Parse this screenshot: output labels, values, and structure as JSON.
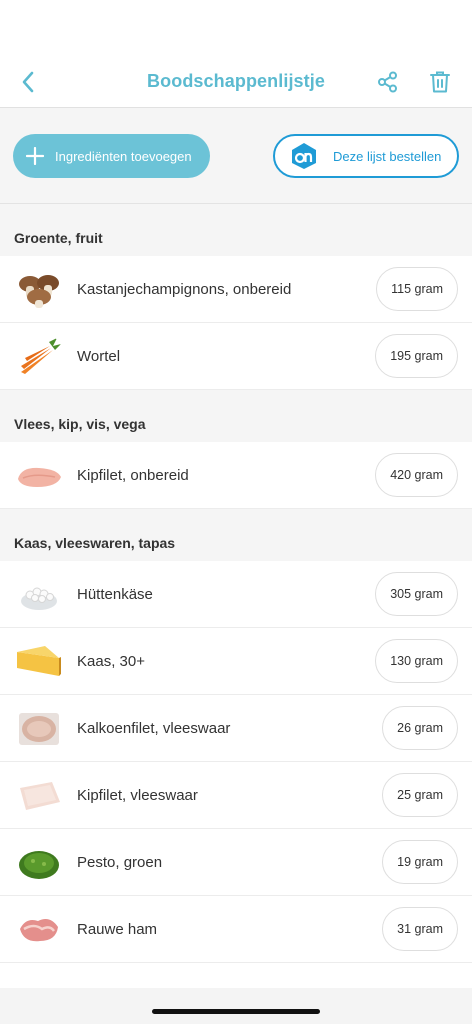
{
  "header": {
    "title": "Boodschappenlijstje"
  },
  "actions": {
    "add_label": "Ingrediënten toevoegen",
    "order_label": "Deze lijst bestellen"
  },
  "sections": [
    {
      "title": "Groente, fruit",
      "items": [
        {
          "name": "Kastanjechampignons, onbereid",
          "qty": "115 gram"
        },
        {
          "name": "Wortel",
          "qty": "195 gram"
        }
      ]
    },
    {
      "title": "Vlees, kip, vis, vega",
      "items": [
        {
          "name": "Kipfilet, onbereid",
          "qty": "420 gram"
        }
      ]
    },
    {
      "title": "Kaas, vleeswaren, tapas",
      "items": [
        {
          "name": "Hüttenkäse",
          "qty": "305 gram"
        },
        {
          "name": "Kaas, 30+",
          "qty": "130 gram"
        },
        {
          "name": "Kalkoenfilet, vleeswaar",
          "qty": "26 gram"
        },
        {
          "name": "Kipfilet, vleeswaar",
          "qty": "25 gram"
        },
        {
          "name": "Pesto, groen",
          "qty": "19 gram"
        },
        {
          "name": "Rauwe ham",
          "qty": "31 gram"
        }
      ]
    }
  ],
  "colors": {
    "accent": "#5bbad0",
    "add_button": "#6cc3d7",
    "ah_blue": "#1f9bd6"
  }
}
